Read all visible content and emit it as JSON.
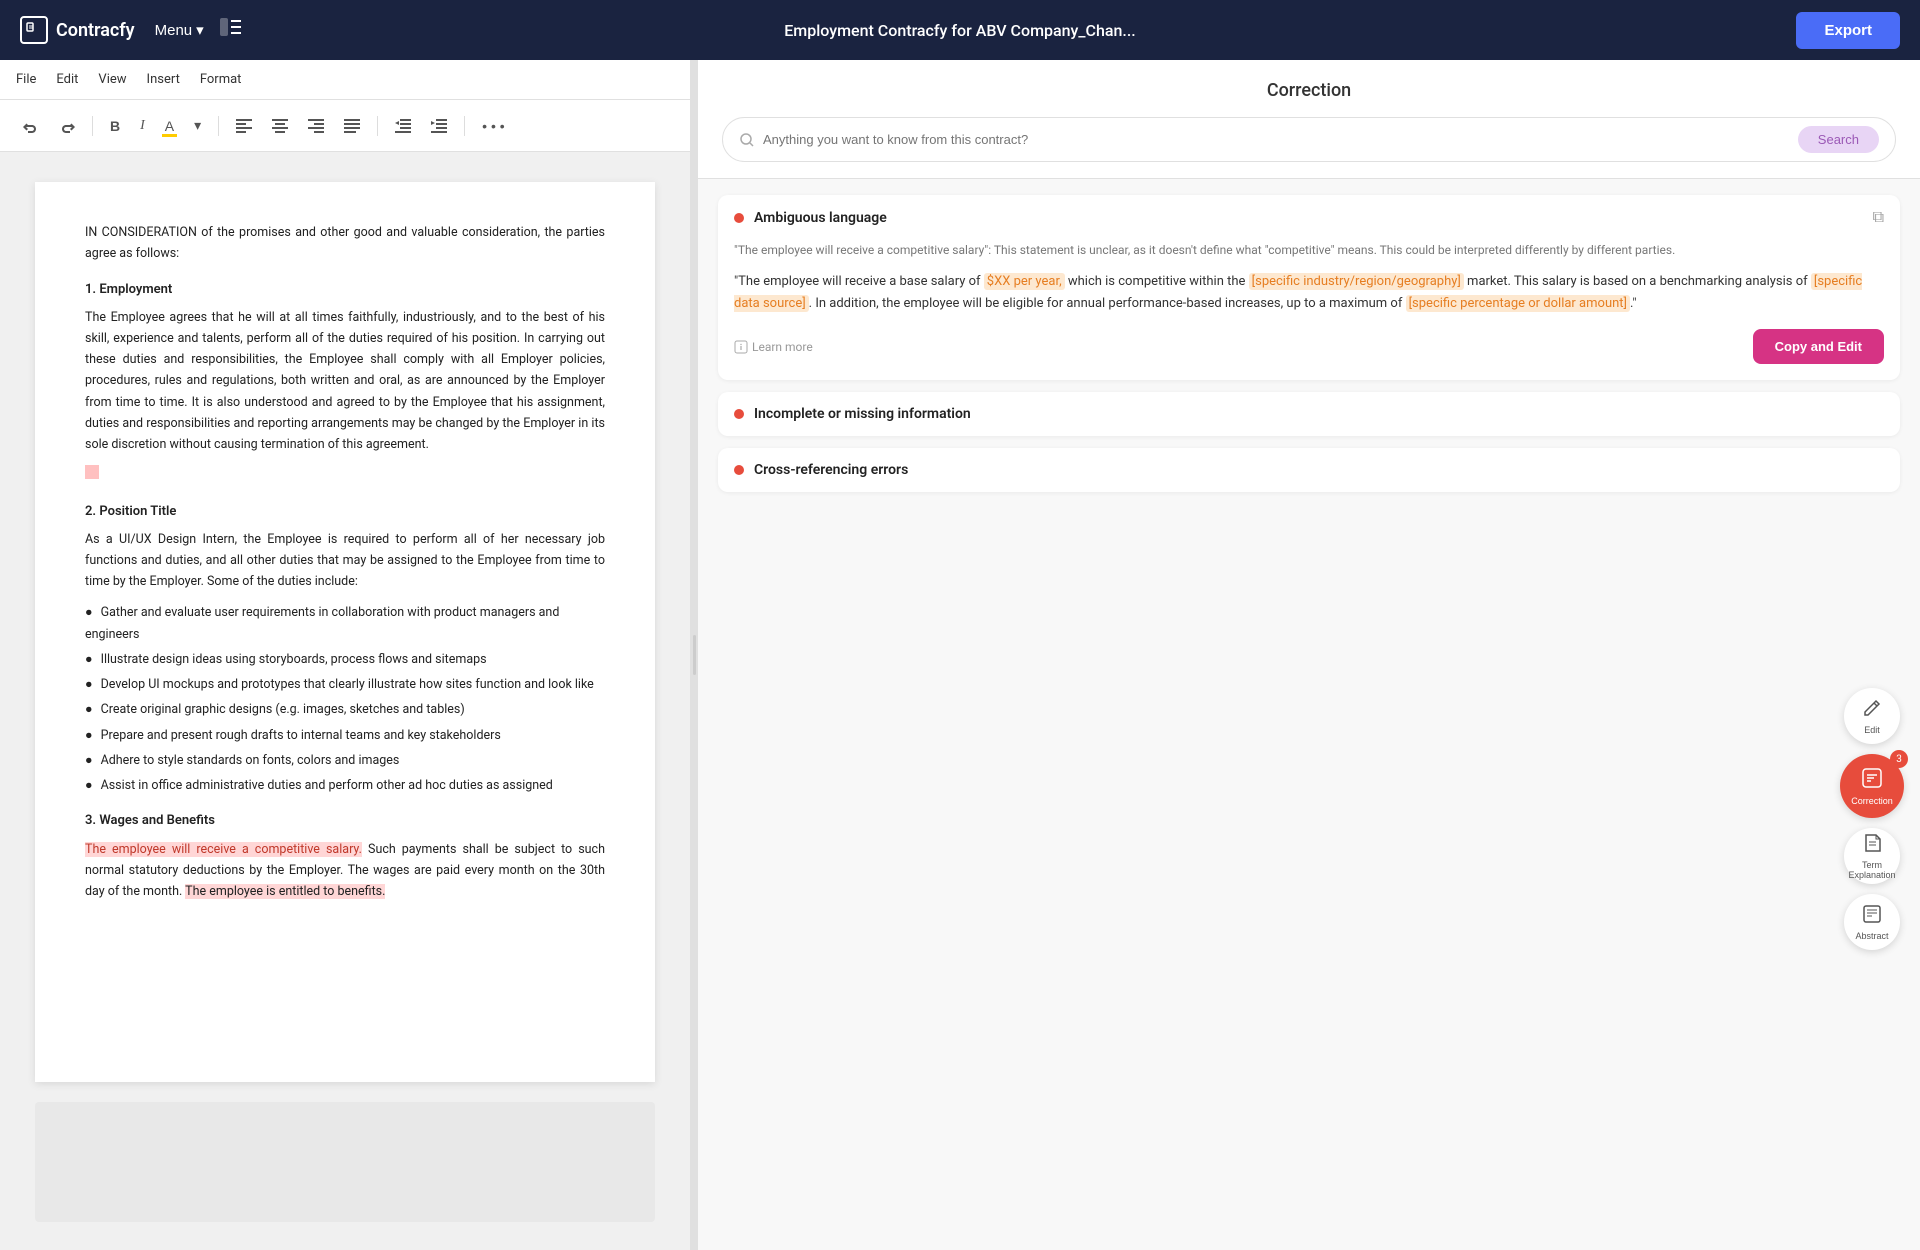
{
  "topnav": {
    "brand": "Contracfy",
    "menu_label": "Menu",
    "doc_title": "Employment Contracfy for ABV Company_Chan...",
    "export_label": "Export"
  },
  "toolbar": {
    "file": "File",
    "edit": "Edit",
    "view": "View",
    "insert": "Insert",
    "format": "Format"
  },
  "correction_panel": {
    "title": "Correction",
    "search_placeholder": "Anything you want to know from this contract?",
    "search_btn": "Search"
  },
  "cards": [
    {
      "title": "Ambiguous language",
      "description": "\"The employee will receive a competitive salary\": This statement is unclear, as it doesn't define what \"competitive\" means. This could be interpreted differently by different parties.",
      "quote": "\"The employee will receive a base salary of $XX per year, which is competitive within the [specific industry/region/geography] market. This salary is based on a benchmarking analysis of [specific data source]. In addition, the employee will be eligible for annual performance-based increases, up to a maximum of [specific percentage or dollar amount].\"",
      "learn_more": "Learn more",
      "copy_edit_btn": "Copy and Edit",
      "expanded": true
    },
    {
      "title": "Incomplete or missing information",
      "expanded": false
    },
    {
      "title": "Cross-referencing errors",
      "expanded": false
    }
  ],
  "document": {
    "intro": "IN CONSIDERATION of the promises and other good and valuable consideration, the parties agree as follows:",
    "section1_title": "1. Employment",
    "section1_body": "The Employee agrees that he will at all times faithfully, industriously, and to the best of his skill, experience and talents, perform all of the duties required of his position. In carrying out these duties and responsibilities, the Employee shall comply with all Employer policies, procedures, rules and regulations, both written and oral, as are announced by the Employer from time to time. It is also understood and agreed to by the Employee that his assignment, duties and responsibilities and reporting arrangements may be changed by the Employer in its sole discretion without causing termination of this agreement.",
    "section2_title": "2. Position Title",
    "section2_body": "As a UI/UX Design Intern, the Employee is required to perform all of her necessary job functions and duties, and all other duties that may be assigned to the Employee from time to time by the Employer. Some of the duties include:",
    "bullets": [
      "Gather and evaluate user requirements in collaboration with product managers and engineers",
      "Illustrate design ideas using storyboards, process flows and sitemaps",
      "Develop UI mockups and prototypes that clearly illustrate how sites function and look like",
      "Create original graphic designs (e.g. images, sketches and tables)",
      "Prepare and present rough drafts to internal teams and key stakeholders",
      "Adhere to style standards on fonts, colors and images",
      "Assist in office administrative duties and perform other ad hoc duties as assigned"
    ],
    "section3_title": "3. Wages and Benefits",
    "section3_body_highlighted": "The employee will receive a competitive salary.",
    "section3_body_rest": " Such payments shall be subject to such normal statutory deductions by the Employer. The wages are paid every month on the 30th day of the month.",
    "section3_body_end_highlighted": "The employee is entitled to benefits."
  },
  "fab": {
    "edit_label": "Edit",
    "correction_label": "Correction",
    "correction_badge": "3",
    "term_label": "Term Explanation",
    "abstract_label": "Abstract"
  }
}
